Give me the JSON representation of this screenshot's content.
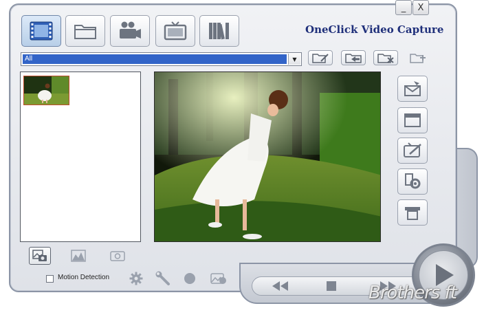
{
  "window": {
    "title": "OneClick Video Capture",
    "minimize_label": "_",
    "close_label": "X"
  },
  "mode_buttons": [
    {
      "icon": "film-icon",
      "active": true
    },
    {
      "icon": "folder-icon",
      "active": false
    },
    {
      "icon": "camcorder-icon",
      "active": false
    },
    {
      "icon": "tv-icon",
      "active": false
    },
    {
      "icon": "library-books-icon",
      "active": false
    }
  ],
  "category_select": {
    "selected": "All",
    "arrow": "▼"
  },
  "folder_actions": [
    {
      "icon": "folder-edit-icon"
    },
    {
      "icon": "folder-import-icon"
    },
    {
      "icon": "folder-delete-icon"
    },
    {
      "icon": "folder-add-icon"
    }
  ],
  "side_actions": [
    {
      "icon": "send-mail-icon"
    },
    {
      "icon": "window-icon"
    },
    {
      "icon": "tv-edit-icon"
    },
    {
      "icon": "usb-settings-icon"
    },
    {
      "icon": "stack-icon"
    }
  ],
  "bottom_actions": [
    {
      "icon": "snapshot-icon"
    },
    {
      "icon": "image-histogram-icon"
    },
    {
      "icon": "camera-icon"
    }
  ],
  "motion_detection": {
    "label": "Motion Detection",
    "checked": false
  },
  "tools": [
    {
      "icon": "gear-icon"
    },
    {
      "icon": "wrench-icon"
    },
    {
      "icon": "record-dot-icon"
    },
    {
      "icon": "image-camera-icon"
    }
  ],
  "playback": {
    "rewind": "rewind-icon",
    "stop": "stop-icon",
    "forward": "fast-forward-icon",
    "play": "play-icon"
  },
  "watermark": "Brothers ft",
  "colors": {
    "title": "#1f2f7a",
    "selection": "#3264c8",
    "thumb_border": "#c24a2c"
  }
}
